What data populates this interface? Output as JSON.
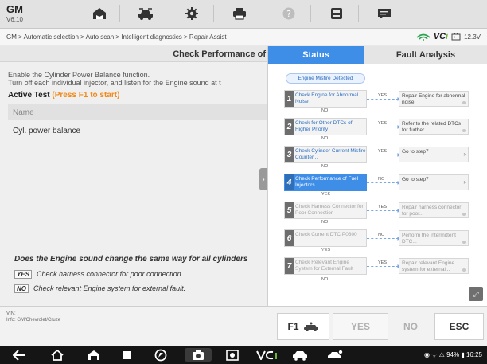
{
  "app": {
    "make": "GM",
    "version": "V6.10"
  },
  "toolbar": {
    "icons": [
      "home-icon",
      "vehicle-swap-icon",
      "settings-icon",
      "print-icon",
      "help-icon",
      "save-icon",
      "message-icon"
    ]
  },
  "breadcrumb": "GM > Automatic selection > Auto scan > Intelligent diagnostics > Repair Assist",
  "vci": {
    "brand": "VC",
    "brand_accent": "i",
    "voltage": "12.3V"
  },
  "left": {
    "title": "Check Performance of",
    "desc_line1": "Enable the Cylinder Power Balance function.",
    "desc_line2": "Turn off each individual injector, and listen for the Engine sound at t",
    "active_test": "Active Test",
    "active_hint": "(Press F1 to start)",
    "name_header": "Name",
    "row": "Cyl. power balance",
    "question": "Does the Engine sound change the same way for all cylinders",
    "answers": [
      {
        "key": "YES",
        "text": "Check harness connector for poor connection."
      },
      {
        "key": "NO",
        "text": "Check relevant Engine system for external fault."
      }
    ]
  },
  "right": {
    "tabs": [
      "Status",
      "Fault Analysis"
    ],
    "start": "Engine Misfire Detected",
    "steps": [
      {
        "num": "1",
        "label": "Check Engine for Abnormal Noise",
        "branch": "YES",
        "result": "Repair Engine for abnormal noise.",
        "down": "NO"
      },
      {
        "num": "2",
        "label": "Check for Other DTCs of Higher Priority",
        "branch": "YES",
        "result": "Refer to the related DTCs for further...",
        "down": "NO"
      },
      {
        "num": "3",
        "label": "Check Cylinder Current Misfire Counter...",
        "branch": "YES",
        "result": "Go to step7",
        "down": "NO"
      },
      {
        "num": "4",
        "label": "Check Performance of Fuel Injectors",
        "branch": "NO",
        "result": "Go to step7",
        "down": "YES"
      },
      {
        "num": "5",
        "label": "Check Harness Connector for Poor Connection",
        "branch": "YES",
        "result": "Repair harness connector for poor...",
        "down": "NO"
      },
      {
        "num": "6",
        "label": "Check Current DTC P0300",
        "branch": "NO",
        "result": "Perform the intermittent DTC...",
        "down": "YES"
      },
      {
        "num": "7",
        "label": "Check Relevant Engine System for External Fault",
        "branch": "YES",
        "result": "Repair relevant Engine system for external...",
        "down": "NO"
      }
    ]
  },
  "bottom": {
    "vin_label": "VIN:",
    "info": "Info: GM/Chevrolet/Cruze",
    "buttons": {
      "f1": "F1",
      "yes": "YES",
      "no": "NO",
      "esc": "ESC"
    }
  },
  "statusbar": {
    "battery": "94%",
    "time": "16:25"
  },
  "colors": {
    "accent": "#3e8de6",
    "hint": "#f08a1c",
    "vci_green": "#6cb33e"
  }
}
